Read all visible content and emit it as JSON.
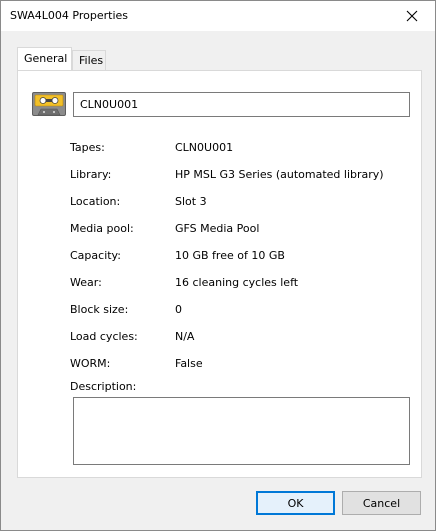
{
  "window": {
    "title": "SWA4L004 Properties"
  },
  "tabs": [
    {
      "label": "General",
      "active": true
    },
    {
      "label": "Files",
      "active": false
    }
  ],
  "general": {
    "icon": "tape-cartridge-icon",
    "name_value": "CLN0U001",
    "properties": [
      {
        "label": "Tapes:",
        "value": "CLN0U001"
      },
      {
        "label": "Library:",
        "value": "HP MSL G3 Series (automated library)"
      },
      {
        "label": "Location:",
        "value": "Slot 3"
      },
      {
        "label": "Media pool:",
        "value": "GFS Media Pool"
      },
      {
        "label": "Capacity:",
        "value": "10 GB free of 10 GB"
      },
      {
        "label": "Wear:",
        "value": "16 cleaning cycles left"
      },
      {
        "label": "Block size:",
        "value": "0"
      },
      {
        "label": "Load cycles:",
        "value": "N/A"
      },
      {
        "label": "WORM:",
        "value": "False"
      }
    ],
    "description_label": "Description:",
    "description_value": ""
  },
  "buttons": {
    "ok_label": "OK",
    "cancel_label": "Cancel"
  },
  "colors": {
    "accent": "#0078d7",
    "dialog_bg": "#f0f0f0",
    "panel_bg": "#ffffff"
  }
}
